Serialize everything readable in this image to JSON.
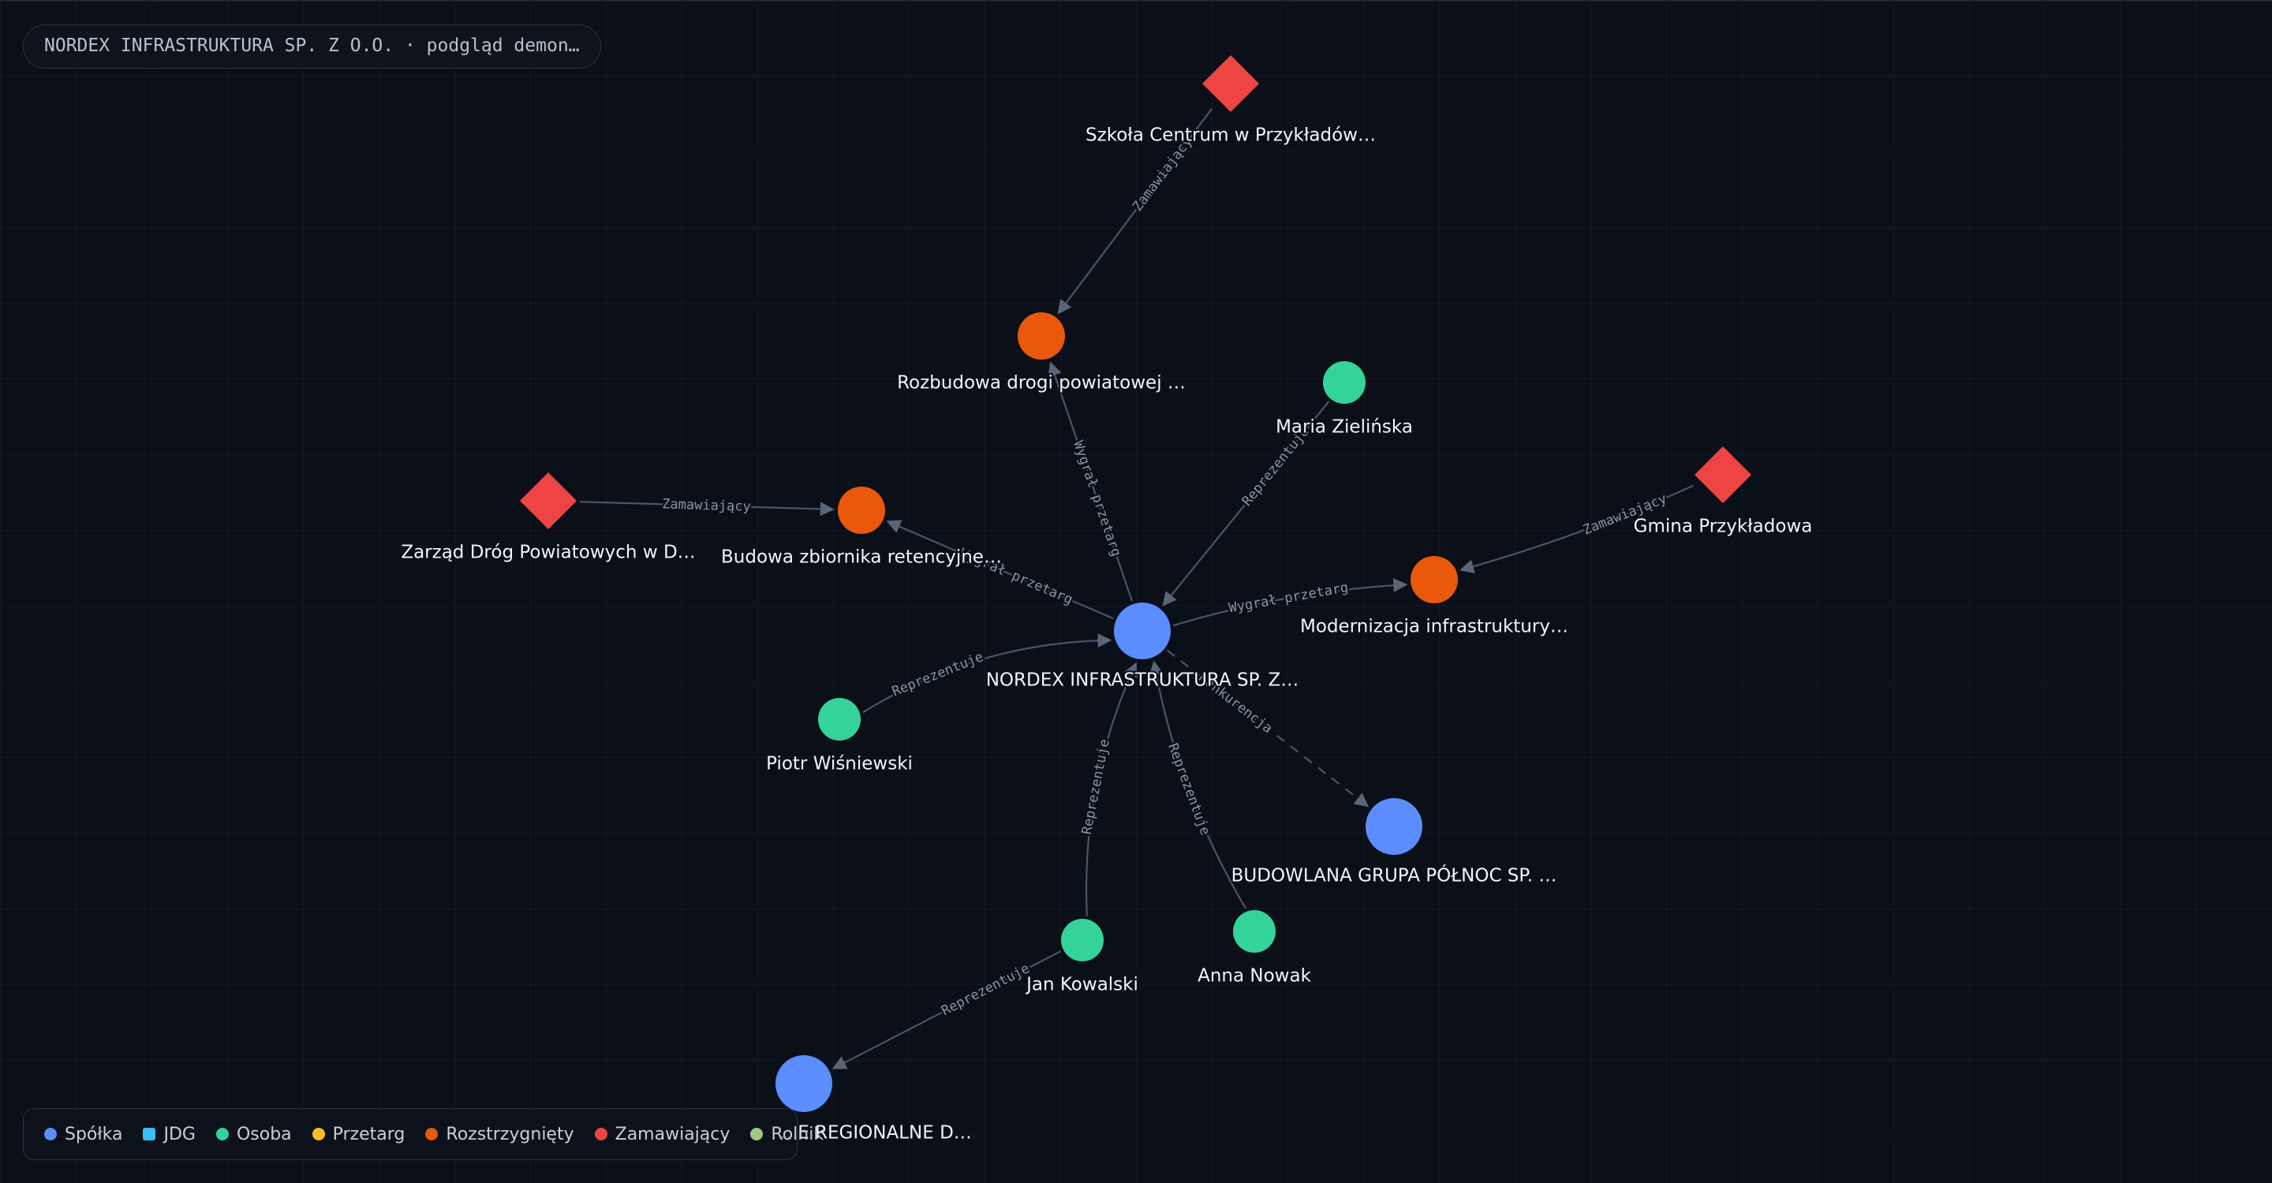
{
  "header": {
    "title": "NORDEX INFRASTRUKTURA SP. Z O.O. · podgląd demon…"
  },
  "colors": {
    "spolka": "#5b8dff",
    "jdg": "#38bdf8",
    "osoba": "#34d399",
    "przetarg": "#fbbf24",
    "rozstrzygniety": "#ea580c",
    "zamawiajacy": "#ef4444",
    "rolnik": "#a3c785",
    "edge": "#4a5568"
  },
  "legend": {
    "items": [
      {
        "label": "Spółka",
        "type": "spolka",
        "shape": "circle"
      },
      {
        "label": "JDG",
        "type": "jdg",
        "shape": "square"
      },
      {
        "label": "Osoba",
        "type": "osoba",
        "shape": "circle"
      },
      {
        "label": "Przetarg",
        "type": "przetarg",
        "shape": "circle"
      },
      {
        "label": "Rozstrzygnięty",
        "type": "rozstrzygniety",
        "shape": "circle"
      },
      {
        "label": "Zamawiający",
        "type": "zamawiajacy",
        "shape": "circle"
      },
      {
        "label": "Rolnik",
        "type": "rolnik",
        "shape": "circle"
      }
    ]
  },
  "graph": {
    "nodes": [
      {
        "id": "nordex",
        "label": "NORDEX INFRASTRUKTURA SP. Z…",
        "type": "spolka"
      },
      {
        "id": "budowlana",
        "label": "BUDOWLANA GRUPA PÓŁNOC SP. …",
        "type": "spolka"
      },
      {
        "id": "regionalne",
        "label": "…E REGIONALNE D…",
        "type": "spolka"
      },
      {
        "id": "maria",
        "label": "Maria Zielińska",
        "type": "osoba"
      },
      {
        "id": "piotr",
        "label": "Piotr Wiśniewski",
        "type": "osoba"
      },
      {
        "id": "jan",
        "label": "Jan Kowalski",
        "type": "osoba"
      },
      {
        "id": "anna",
        "label": "Anna Nowak",
        "type": "osoba"
      },
      {
        "id": "rozbudowa",
        "label": "Rozbudowa drogi powiatowej …",
        "type": "rozstrzygniety"
      },
      {
        "id": "zbiornik",
        "label": "Budowa zbiornika retencyjne…",
        "type": "rozstrzygniety"
      },
      {
        "id": "modernizacja",
        "label": "Modernizacja infrastruktury…",
        "type": "rozstrzygniety"
      },
      {
        "id": "szkola",
        "label": "Szkoła Centrum w Przykładów…",
        "type": "zamawiajacy"
      },
      {
        "id": "zarzad",
        "label": "Zarząd Dróg Powiatowych w D…",
        "type": "zamawiajacy"
      },
      {
        "id": "gmina",
        "label": "Gmina Przykładowa",
        "type": "zamawiajacy"
      }
    ],
    "edges": [
      {
        "from": "szkola",
        "to": "rozbudowa",
        "label": "Zamawiający"
      },
      {
        "from": "zarzad",
        "to": "zbiornik",
        "label": "Zamawiający"
      },
      {
        "from": "gmina",
        "to": "modernizacja",
        "label": "Zamawiający"
      },
      {
        "from": "nordex",
        "to": "rozbudowa",
        "label": "Wygrał przetarg"
      },
      {
        "from": "nordex",
        "to": "zbiornik",
        "label": "Wygrał przetarg"
      },
      {
        "from": "nordex",
        "to": "modernizacja",
        "label": "Wygrał przetarg"
      },
      {
        "from": "maria",
        "to": "nordex",
        "label": "Reprezentuje"
      },
      {
        "from": "piotr",
        "to": "nordex",
        "label": "Reprezentuje"
      },
      {
        "from": "jan",
        "to": "nordex",
        "label": "Reprezentuje"
      },
      {
        "from": "anna",
        "to": "nordex",
        "label": "Reprezentuje"
      },
      {
        "from": "jan",
        "to": "regionalne",
        "label": "Reprezentuje"
      },
      {
        "from": "nordex",
        "to": "budowlana",
        "label": "Konkurencja",
        "dashed": true
      }
    ]
  }
}
